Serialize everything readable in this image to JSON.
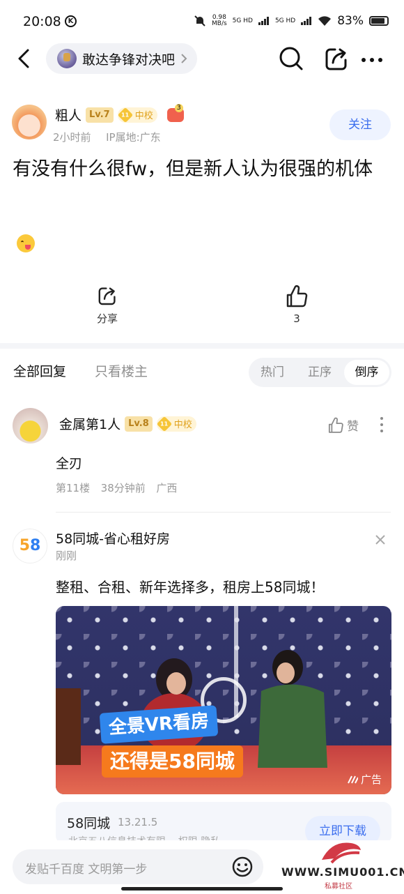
{
  "status_bar": {
    "time": "20:08",
    "k_icon": "K",
    "net_speed_top": "0.98",
    "net_speed_unit": "MB/s",
    "signal1": "5G HD",
    "signal2": "5G HD",
    "battery": "83%"
  },
  "nav": {
    "forum_name": "敢达争锋对决吧"
  },
  "post": {
    "author": "粗人",
    "level": "Lv.7",
    "school_level": "11",
    "school": "中校",
    "time": "2小时前",
    "ip": "IP属地:广东",
    "follow_label": "关注",
    "title": "有没有什么很fw，但是新人认为很强的机体",
    "share_label": "分享",
    "like_count": "3"
  },
  "tabs": {
    "all": "全部回复",
    "op_only": "只看楼主",
    "sort": [
      "热门",
      "正序",
      "倒序"
    ],
    "active_sort": "倒序"
  },
  "comment": {
    "name": "金属第1人",
    "level": "Lv.8",
    "school_level": "11",
    "school": "中校",
    "like_label": "赞",
    "body": "全刃",
    "floor": "第11楼",
    "time": "38分钟前",
    "location": "广西"
  },
  "ad": {
    "name": "58同城-省心租好房",
    "time": "刚刚",
    "text": "整租、合租、新年选择多，租房上58同城！",
    "banner1": "全景VR看房",
    "banner2": "还得是58同城",
    "ad_tag": "广告",
    "app_name": "58同城",
    "app_version": "13.21.5",
    "app_sub": "北京五八信息技术有限...    权限   隐私",
    "download_label": "立即下载"
  },
  "bottom": {
    "placeholder": "发贴千百度 文明第一步"
  },
  "watermark": {
    "text": "WWW.SIMU001.CN",
    "sub": "私募社区"
  },
  "colors": {
    "accent": "#3a6dee",
    "level_badge": "#f8e1a7",
    "ad_banner_blue": "#2f86ec",
    "ad_banner_orange": "#f67a1d"
  }
}
